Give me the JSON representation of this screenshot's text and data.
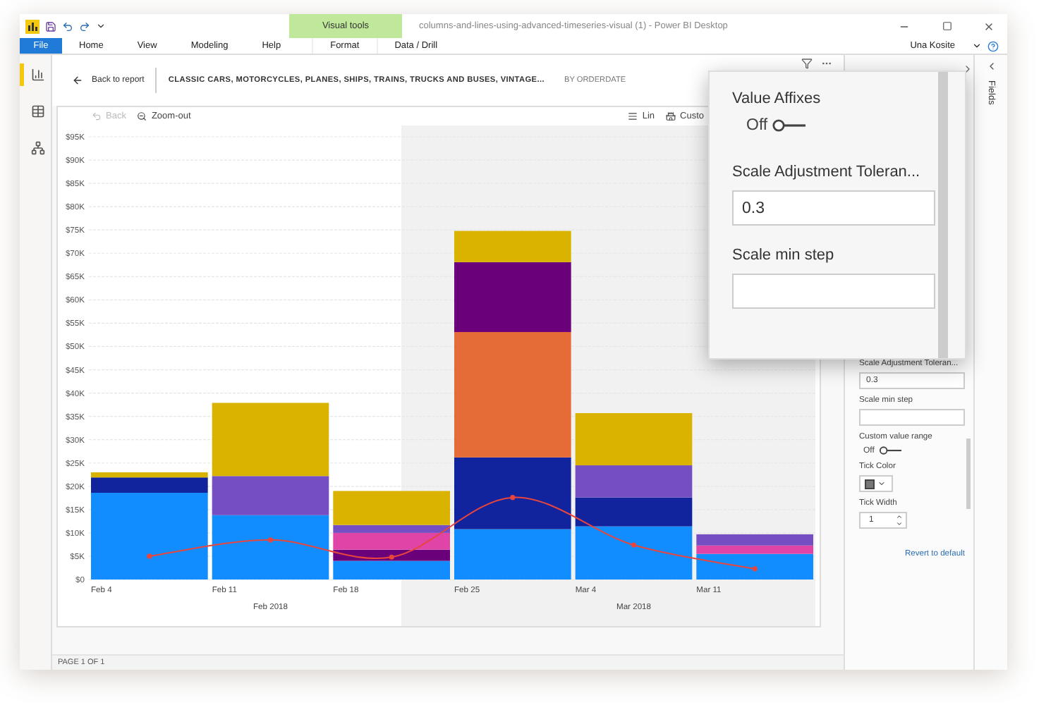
{
  "window": {
    "title": "columns-and-lines-using-advanced-timeseries-visual (1) - Power BI Desktop",
    "context_tab_group": "Visual tools",
    "user": "Una Kosite"
  },
  "ribbon_tabs": [
    {
      "label": "File",
      "kind": "file",
      "selected": false
    },
    {
      "label": "Home",
      "kind": "tab",
      "selected": false
    },
    {
      "label": "View",
      "kind": "tab",
      "selected": false
    },
    {
      "label": "Modeling",
      "kind": "tab",
      "selected": false
    },
    {
      "label": "Help",
      "kind": "tab",
      "selected": false
    },
    {
      "label": "Format",
      "kind": "context",
      "selected": false
    },
    {
      "label": "Data / Drill",
      "kind": "context",
      "selected": false
    }
  ],
  "rail": [
    {
      "kind": "report",
      "selected": true
    },
    {
      "kind": "data",
      "selected": false
    },
    {
      "kind": "model",
      "selected": false
    }
  ],
  "focus_header": {
    "back": "Back to report",
    "title": "CLASSIC CARS, MOTORCYCLES, PLANES, SHIPS, TRAINS, TRUCKS AND BUSES, VINTAGE...",
    "subtitle": "BY ORDERDATE"
  },
  "visual_toolbar": {
    "left": [
      {
        "label": "Back",
        "disabled": true
      },
      {
        "label": "Zoom-out",
        "disabled": false
      }
    ],
    "right": [
      "Lin",
      "Custo"
    ]
  },
  "chart": {
    "chart_data": {
      "type": "bar",
      "stacked": true,
      "grid": true,
      "categories": [
        "Feb 4",
        "Feb 11",
        "Feb 18",
        "Feb 25",
        "Mar 4",
        "Mar 11"
      ],
      "ylim": [
        0,
        95000
      ],
      "yticks": [
        {
          "value": 0,
          "label": "$0"
        },
        {
          "value": 5000,
          "label": "$5K"
        },
        {
          "value": 10000,
          "label": "$10K"
        },
        {
          "value": 15000,
          "label": "$15K"
        },
        {
          "value": 20000,
          "label": "$20K"
        },
        {
          "value": 25000,
          "label": "$25K"
        },
        {
          "value": 30000,
          "label": "$30K"
        },
        {
          "value": 35000,
          "label": "$35K"
        },
        {
          "value": 40000,
          "label": "$40K"
        },
        {
          "value": 45000,
          "label": "$45K"
        },
        {
          "value": 50000,
          "label": "$50K"
        },
        {
          "value": 55000,
          "label": "$55K"
        },
        {
          "value": 60000,
          "label": "$60K"
        },
        {
          "value": 65000,
          "label": "$65K"
        },
        {
          "value": 70000,
          "label": "$70K"
        },
        {
          "value": 75000,
          "label": "$75K"
        },
        {
          "value": 80000,
          "label": "$80K"
        },
        {
          "value": 85000,
          "label": "$85K"
        },
        {
          "value": 90000,
          "label": "$90K"
        },
        {
          "value": 95000,
          "label": "$95K"
        }
      ],
      "series": [
        {
          "type": "bar",
          "color": "#118dff",
          "values": [
            18600,
            13800,
            4000,
            10800,
            11400,
            5500
          ]
        },
        {
          "type": "bar",
          "color": "#12239e",
          "values": [
            3300,
            null,
            null,
            15400,
            6200,
            null
          ]
        },
        {
          "type": "bar",
          "color": "#e66c37",
          "values": [
            null,
            null,
            null,
            26900,
            null,
            null
          ]
        },
        {
          "type": "bar",
          "color": "#6b007b",
          "values": [
            null,
            null,
            2400,
            15000,
            null,
            null
          ]
        },
        {
          "type": "bar",
          "color": "#e044a7",
          "values": [
            null,
            null,
            3600,
            null,
            null,
            1800
          ]
        },
        {
          "type": "bar",
          "color": "#744ec2",
          "values": [
            null,
            8400,
            1700,
            null,
            6900,
            2400
          ]
        },
        {
          "type": "bar",
          "color": "#d9b300",
          "values": [
            1100,
            15700,
            7300,
            6700,
            11200,
            null
          ]
        },
        {
          "type": "line",
          "color": "#e8453c",
          "marker": "circle",
          "values": [
            5000,
            8500,
            4800,
            17600,
            7400,
            2300
          ]
        }
      ]
    },
    "x_groups": [
      {
        "label": "Feb 2018",
        "shaded": false
      },
      {
        "label": "Mar 2018",
        "shaded": true
      }
    ]
  },
  "status_bar": "PAGE 1 OF 1",
  "format_pane": {
    "items": [
      {
        "kind": "input",
        "label": "Scale Adjustment Toleran...",
        "value": "0.3"
      },
      {
        "kind": "input",
        "label": "Scale min step",
        "value": ""
      },
      {
        "kind": "toggle",
        "label": "Custom value range",
        "text": "Off",
        "on": false
      },
      {
        "kind": "color",
        "label": "Tick Color"
      },
      {
        "kind": "spinner",
        "label": "Tick Width",
        "value": "1"
      }
    ],
    "revert": "Revert to default"
  },
  "fields_pane": {
    "label": "Fields"
  },
  "popup": {
    "items": [
      {
        "kind": "toggle",
        "label": "Value Affixes",
        "text": "Off",
        "on": false
      },
      {
        "kind": "input",
        "label": "Scale Adjustment Toleran...",
        "value": "0.3"
      },
      {
        "kind": "input",
        "label": "Scale min step",
        "value": ""
      }
    ]
  }
}
